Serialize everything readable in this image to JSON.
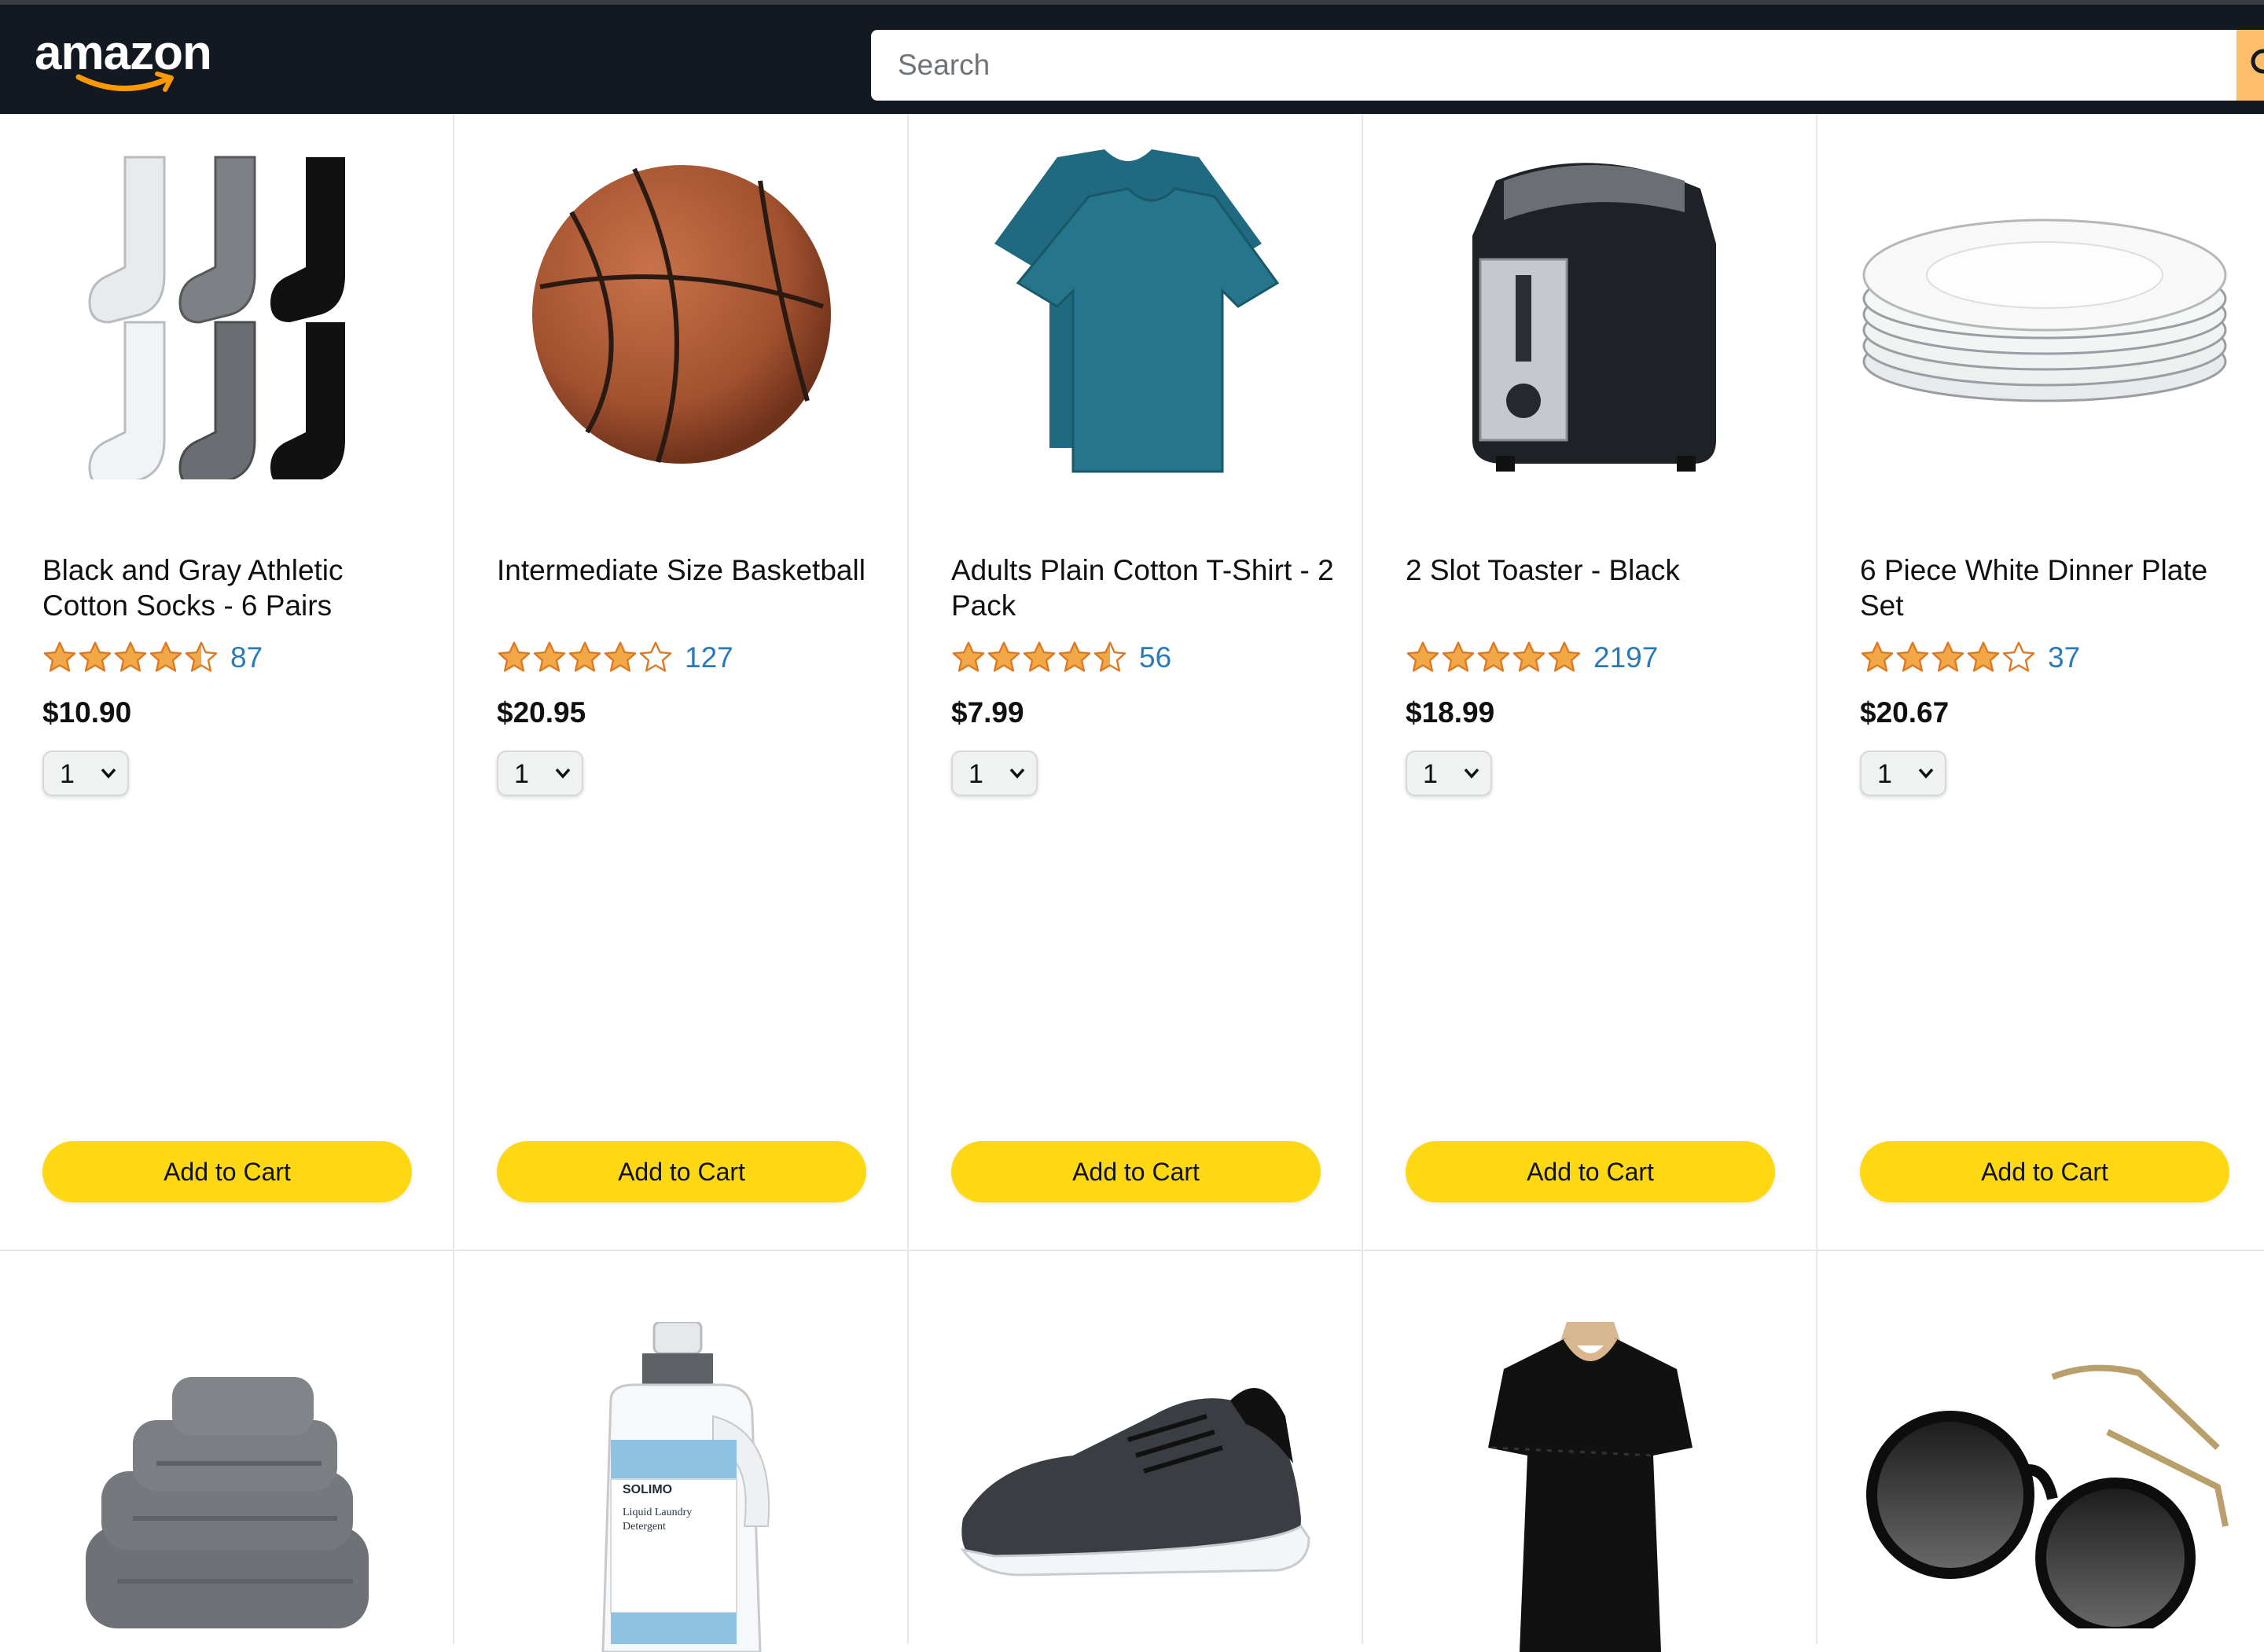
{
  "header": {
    "logo_text": "amazon",
    "search": {
      "placeholder": "Search",
      "value": ""
    }
  },
  "colors": {
    "header_bg": "#131921",
    "star": "#f3a847",
    "cart_button": "#ffd814",
    "link": "#2a7ab8"
  },
  "products": [
    {
      "name": "Black and Gray Athletic Cotton Socks - 6 Pairs",
      "rating_stars": 4.5,
      "rating_count": "87",
      "price": "$10.90",
      "quantity": "1",
      "button": "Add to Cart",
      "image_icon": "socks-image"
    },
    {
      "name": "Intermediate Size Basketball",
      "rating_stars": 4.0,
      "rating_count": "127",
      "price": "$20.95",
      "quantity": "1",
      "button": "Add to Cart",
      "image_icon": "basketball-image"
    },
    {
      "name": "Adults Plain Cotton T-Shirt - 2 Pack",
      "rating_stars": 4.5,
      "rating_count": "56",
      "price": "$7.99",
      "quantity": "1",
      "button": "Add to Cart",
      "image_icon": "tshirt-image"
    },
    {
      "name": "2 Slot Toaster - Black",
      "rating_stars": 5.0,
      "rating_count": "2197",
      "price": "$18.99",
      "quantity": "1",
      "button": "Add to Cart",
      "image_icon": "toaster-image"
    },
    {
      "name": "6 Piece White Dinner Plate Set",
      "rating_stars": 4.0,
      "rating_count": "37",
      "price": "$20.67",
      "quantity": "1",
      "button": "Add to Cart",
      "image_icon": "plates-image"
    },
    {
      "image_icon": "towels-image"
    },
    {
      "image_icon": "detergent-image",
      "image_text": [
        "SOLIMO",
        "Liquid Laundry",
        "Detergent"
      ]
    },
    {
      "image_icon": "sneaker-image"
    },
    {
      "image_icon": "dress-image"
    },
    {
      "image_icon": "sunglasses-image"
    }
  ]
}
